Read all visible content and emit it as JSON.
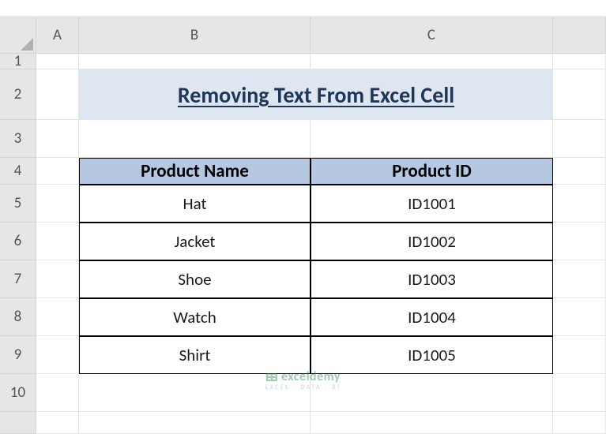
{
  "columns": {
    "A": "A",
    "B": "B",
    "C": "C"
  },
  "rows": [
    "1",
    "2",
    "3",
    "4",
    "5",
    "6",
    "7",
    "8",
    "9",
    "10"
  ],
  "title": "Removing Text From Excel Cell",
  "headers": {
    "name": "Product Name",
    "id": "Product ID"
  },
  "data": [
    {
      "name": "Hat",
      "id": "ID1001"
    },
    {
      "name": "Jacket",
      "id": "ID1002"
    },
    {
      "name": "Shoe",
      "id": "ID1003"
    },
    {
      "name": "Watch",
      "id": "ID1004"
    },
    {
      "name": "Shirt",
      "id": "ID1005"
    }
  ],
  "watermark": {
    "brand": "exceldemy",
    "tagline": "EXCEL · DATA · BI"
  },
  "chart_data": {
    "type": "table",
    "title": "Removing Text From Excel Cell",
    "columns": [
      "Product Name",
      "Product ID"
    ],
    "rows": [
      [
        "Hat",
        "ID1001"
      ],
      [
        "Jacket",
        "ID1002"
      ],
      [
        "Shoe",
        "ID1003"
      ],
      [
        "Watch",
        "ID1004"
      ],
      [
        "Shirt",
        "ID1005"
      ]
    ]
  }
}
